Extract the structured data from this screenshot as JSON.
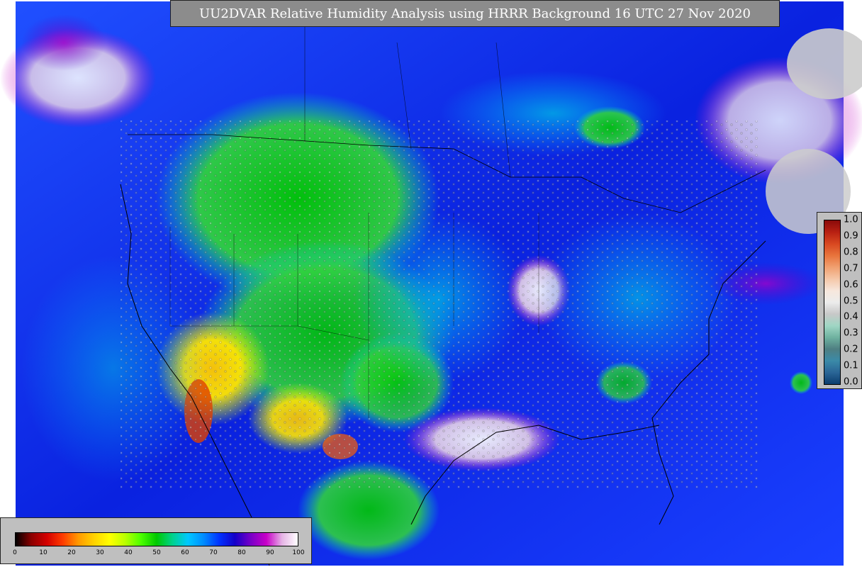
{
  "title": "UU2DVAR Relative Humidity Analysis using HRRR Background 16 UTC 27 Nov 2020",
  "humidity_colorbar": {
    "ticks": [
      "0",
      "10",
      "20",
      "30",
      "40",
      "50",
      "60",
      "70",
      "80",
      "90",
      "100"
    ],
    "colors": [
      "#000000",
      "#8b0000",
      "#d40000",
      "#ff3b00",
      "#ff9900",
      "#ffd200",
      "#ffff00",
      "#b9ff00",
      "#4cff00",
      "#00c800",
      "#00d28c",
      "#00c8ff",
      "#008cff",
      "#0032ff",
      "#1400c8",
      "#7800c8",
      "#c800c8",
      "#e6b4e6",
      "#ffffff"
    ]
  },
  "observation_colorbar": {
    "ticks": [
      "0.0",
      "0.1",
      "0.2",
      "0.3",
      "0.4",
      "0.5",
      "0.6",
      "0.7",
      "0.8",
      "0.9",
      "1.0"
    ],
    "colors": [
      "#0b3d6e",
      "#2a6596",
      "#3b8aa8",
      "#4f7f82",
      "#6fb2a0",
      "#a0d6c4",
      "#c8c8c8",
      "#ececec",
      "#f7e7dc",
      "#f5c7a8",
      "#f0a070",
      "#e8743c",
      "#d84820",
      "#b82012",
      "#8a0a0a"
    ]
  }
}
